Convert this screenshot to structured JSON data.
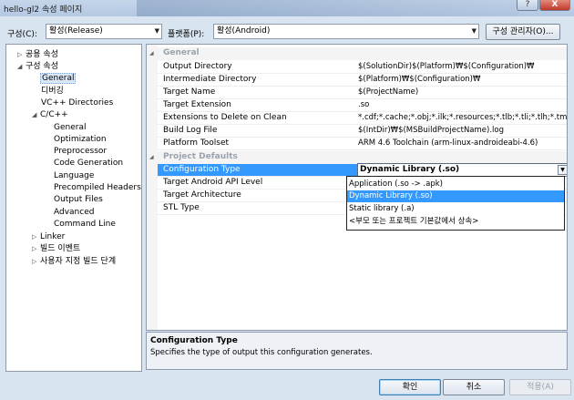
{
  "window": {
    "title": "hello-gl2 속성 페이지",
    "help_label": "?",
    "close_label": "X"
  },
  "toolbar": {
    "config_label": "구성(C):",
    "config_value": "활성(Release)",
    "platform_label": "플랫폼(P):",
    "platform_value": "활성(Android)",
    "config_manager_label": "구성 관리자(O)..."
  },
  "tree": [
    {
      "label": "공용 속성",
      "expander": "▷"
    },
    {
      "label": "구성 속성",
      "expander": "◢"
    },
    {
      "label": "General",
      "expander": ""
    },
    {
      "label": "디버깅",
      "expander": ""
    },
    {
      "label": "VC++ Directories",
      "expander": ""
    },
    {
      "label": "C/C++",
      "expander": "◢"
    },
    {
      "label": "General",
      "expander": ""
    },
    {
      "label": "Optimization",
      "expander": ""
    },
    {
      "label": "Preprocessor",
      "expander": ""
    },
    {
      "label": "Code Generation",
      "expander": ""
    },
    {
      "label": "Language",
      "expander": ""
    },
    {
      "label": "Precompiled Headers",
      "expander": ""
    },
    {
      "label": "Output Files",
      "expander": ""
    },
    {
      "label": "Advanced",
      "expander": ""
    },
    {
      "label": "Command Line",
      "expander": ""
    },
    {
      "label": "Linker",
      "expander": "▷"
    },
    {
      "label": "빌드 이벤트",
      "expander": "▷"
    },
    {
      "label": "사용자 지정 빌드 단계",
      "expander": "▷"
    }
  ],
  "grid": {
    "general_header": "General",
    "general": [
      {
        "name": "Output Directory",
        "value": "$(SolutionDir)$(Platform)₩$(Configuration)₩"
      },
      {
        "name": "Intermediate Directory",
        "value": "$(Platform)₩$(Configuration)₩"
      },
      {
        "name": "Target Name",
        "value": "$(ProjectName)"
      },
      {
        "name": "Target Extension",
        "value": ".so"
      },
      {
        "name": "Extensions to Delete on Clean",
        "value": "*.cdf;*.cache;*.obj;*.ilk;*.resources;*.tlb;*.tli;*.tlh;*.tmp;*.rsp;"
      },
      {
        "name": "Build Log File",
        "value": "$(IntDir)₩$(MSBuildProjectName).log"
      },
      {
        "name": "Platform Toolset",
        "value": "ARM 4.6 Toolchain (arm-linux-androideabi-4.6)"
      }
    ],
    "defaults_header": "Project Defaults",
    "defaults": [
      {
        "name": "Configuration Type",
        "value": "Dynamic Library (.so)"
      },
      {
        "name": "Target Android API Level",
        "value": ""
      },
      {
        "name": "Target Architecture",
        "value": ""
      },
      {
        "name": "STL Type",
        "value": ""
      }
    ]
  },
  "dropdown": {
    "options": [
      "Application (.so -> .apk)",
      "Dynamic Library (.so)",
      "Static library (.a)",
      "<부모 또는 프로젝트 기본값에서 상속>"
    ]
  },
  "description": {
    "title": "Configuration Type",
    "text": "Specifies the type of output this configuration generates."
  },
  "buttons": {
    "ok": "확인",
    "cancel": "취소",
    "apply": "적용(A)"
  }
}
